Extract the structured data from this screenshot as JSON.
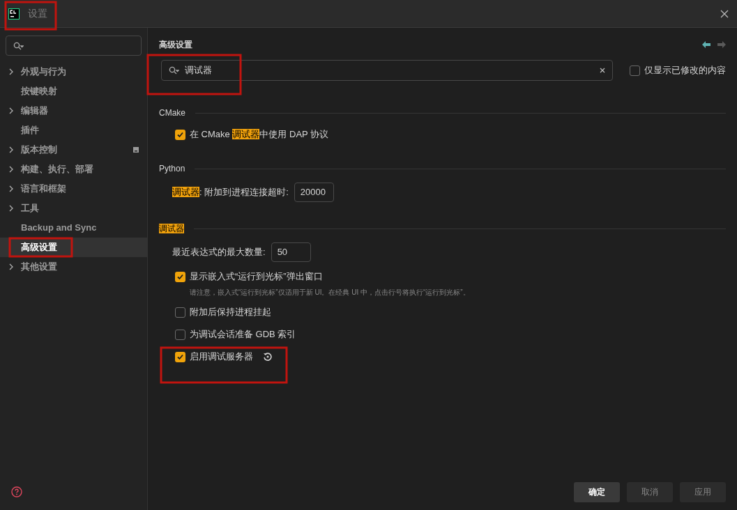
{
  "window": {
    "title": "设置"
  },
  "sidebar": {
    "items": [
      {
        "label": "外观与行为",
        "expandable": true,
        "selected": false,
        "badge_icon": false
      },
      {
        "label": "按键映射",
        "expandable": false,
        "selected": false,
        "badge_icon": false
      },
      {
        "label": "编辑器",
        "expandable": true,
        "selected": false,
        "badge_icon": false
      },
      {
        "label": "插件",
        "expandable": false,
        "selected": false,
        "badge_icon": false
      },
      {
        "label": "版本控制",
        "expandable": true,
        "selected": false,
        "badge_icon": true
      },
      {
        "label": "构建、执行、部署",
        "expandable": true,
        "selected": false,
        "badge_icon": false
      },
      {
        "label": "语言和框架",
        "expandable": true,
        "selected": false,
        "badge_icon": false
      },
      {
        "label": "工具",
        "expandable": true,
        "selected": false,
        "badge_icon": false
      },
      {
        "label": "Backup and Sync",
        "expandable": false,
        "selected": false,
        "badge_icon": false
      },
      {
        "label": "高级设置",
        "expandable": false,
        "selected": true,
        "badge_icon": false
      },
      {
        "label": "其他设置",
        "expandable": true,
        "selected": false,
        "badge_icon": false
      }
    ]
  },
  "main": {
    "title": "高级设置",
    "nav": {
      "back_enabled": true,
      "forward_enabled": false
    },
    "search": {
      "value": "调试器"
    },
    "filter": {
      "label": "仅显示已修改的内容",
      "checked": false
    },
    "sections": [
      {
        "title": [
          {
            "text": "CMake",
            "match": false
          }
        ],
        "items": [
          {
            "kind": "checkbox",
            "checked": true,
            "modified": false,
            "parts": [
              {
                "text": "在 CMake ",
                "match": false
              },
              {
                "text": "调试器",
                "match": true
              },
              {
                "text": "中使用 DAP 协议",
                "match": false
              }
            ]
          }
        ]
      },
      {
        "title": [
          {
            "text": "Python",
            "match": false
          }
        ],
        "items": [
          {
            "kind": "field",
            "value": "20000",
            "parts": [
              {
                "text": "调试器",
                "match": true
              },
              {
                "text": ": 附加到进程连接超时:",
                "match": false
              }
            ]
          }
        ]
      },
      {
        "title": [
          {
            "text": "调试器",
            "match": true
          }
        ],
        "items": [
          {
            "kind": "field",
            "value": "50",
            "parts": [
              {
                "text": "最近表达式的最大数量:",
                "match": false
              }
            ]
          },
          {
            "kind": "checkbox",
            "checked": true,
            "modified": false,
            "parts": [
              {
                "text": "显示嵌入式“运行到光标”弹出窗口",
                "match": false
              }
            ],
            "note": "请注意，嵌入式“运行到光标”仅适用于新 UI。在经典 UI 中，点击行号将执行“运行到光标”。"
          },
          {
            "kind": "checkbox",
            "checked": false,
            "modified": false,
            "parts": [
              {
                "text": "附加后保持进程挂起",
                "match": false
              }
            ]
          },
          {
            "kind": "checkbox",
            "checked": false,
            "modified": false,
            "parts": [
              {
                "text": "为调试会话准备 GDB 索引",
                "match": false
              }
            ]
          },
          {
            "kind": "checkbox",
            "checked": true,
            "modified": true,
            "parts": [
              {
                "text": "启用调试服务器",
                "match": false
              }
            ]
          }
        ]
      }
    ]
  },
  "footer": {
    "buttons": [
      {
        "label": "确定",
        "default": true
      },
      {
        "label": "取消",
        "default": false
      },
      {
        "label": "应用",
        "default": false
      }
    ]
  }
}
